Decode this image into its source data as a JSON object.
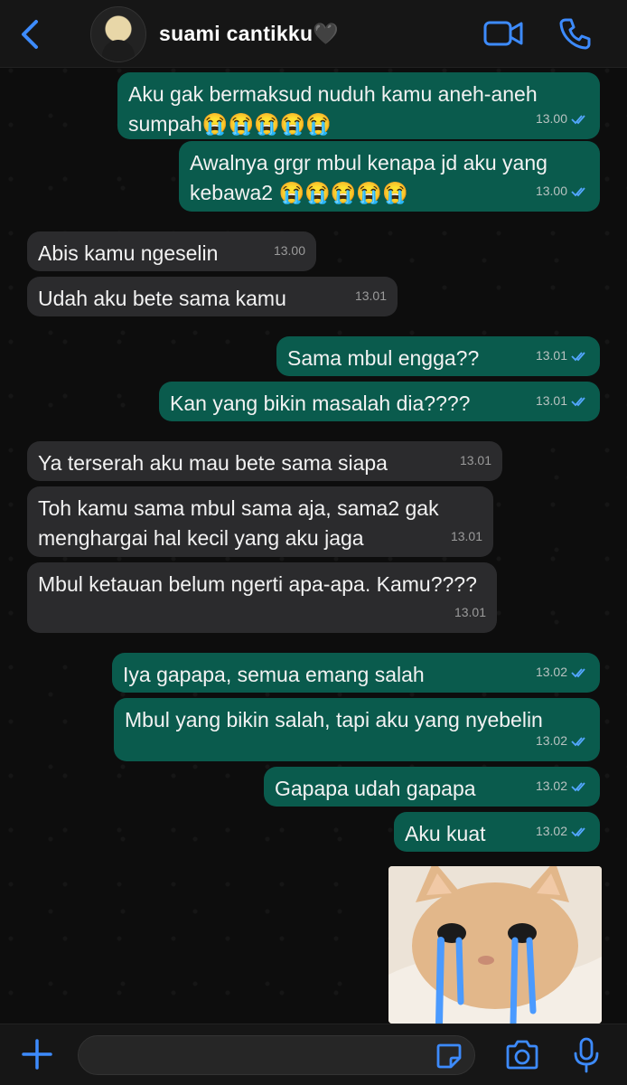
{
  "header": {
    "contact_name": "suami cantikku🖤",
    "icons": {
      "back": "back-chevron-icon",
      "video": "video-call-icon",
      "call": "phone-icon"
    },
    "accent_color": "#3d8bfd"
  },
  "messages": [
    {
      "dir": "out",
      "text": "Aku gak bermaksud nuduh kamu aneh-aneh sumpah😭😭😭😭😭",
      "time": "13.00"
    },
    {
      "dir": "out",
      "text": "Awalnya grgr mbul kenapa jd aku yang kebawa2 😭😭😭😭😭",
      "time": "13.00"
    },
    {
      "dir": "in",
      "text": "Abis kamu ngeselin",
      "time": "13.00"
    },
    {
      "dir": "in",
      "text": "Udah aku bete sama kamu",
      "time": "13.01"
    },
    {
      "dir": "out",
      "text": "Sama mbul engga??",
      "time": "13.01"
    },
    {
      "dir": "out",
      "text": "Kan yang bikin masalah dia????",
      "time": "13.01"
    },
    {
      "dir": "in",
      "text": "Ya terserah aku mau bete sama siapa",
      "time": "13.01"
    },
    {
      "dir": "in",
      "text": "Toh kamu sama mbul sama aja, sama2 gak menghargai hal kecil yang aku jaga",
      "time": "13.01"
    },
    {
      "dir": "in",
      "text": "Mbul ketauan belum ngerti apa-apa. Kamu????",
      "time": "13.01"
    },
    {
      "dir": "out",
      "text": "Iya gapapa, semua emang salah",
      "time": "13.02"
    },
    {
      "dir": "out",
      "text": "Mbul yang bikin salah, tapi aku yang nyebelin",
      "time": "13.02"
    },
    {
      "dir": "out",
      "text": "Gapapa udah gapapa",
      "time": "13.02"
    },
    {
      "dir": "out",
      "text": "Aku kuat",
      "time": "13.02"
    }
  ],
  "sticker": {
    "type": "sticker",
    "subject": "crying-cat-sticker"
  },
  "input_bar": {
    "icons": {
      "attach": "plus-icon",
      "sticker": "sticker-icon",
      "camera": "camera-icon",
      "mic": "microphone-icon"
    }
  },
  "colors": {
    "outgoing_bubble": "#0a5b4d",
    "incoming_bubble": "#2b2b2d",
    "read_ticks": "#53a6ff"
  }
}
